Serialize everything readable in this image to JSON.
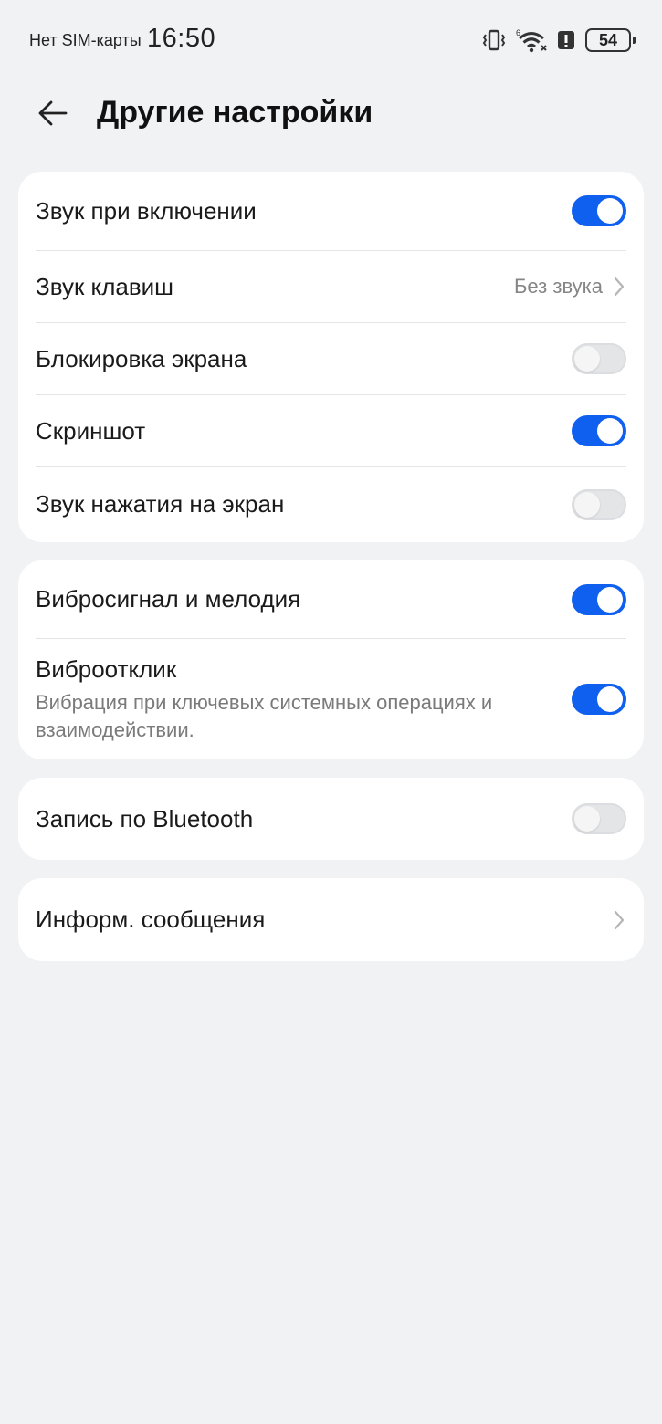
{
  "status_bar": {
    "carrier": "Нет SIM-карты",
    "time": "16:50",
    "battery": "54",
    "icons": [
      "vibrate-icon",
      "wifi-6-icon",
      "battery-saver-alert-icon",
      "battery-icon"
    ]
  },
  "header": {
    "title": "Другие настройки",
    "back_icon": "arrow-left-icon"
  },
  "groups": [
    {
      "items": [
        {
          "label": "Звук при включении",
          "type": "toggle",
          "on": true
        },
        {
          "label": "Звук клавиш",
          "type": "link",
          "value": "Без звука"
        },
        {
          "label": "Блокировка экрана",
          "type": "toggle",
          "on": false
        },
        {
          "label": "Скриншот",
          "type": "toggle",
          "on": true
        },
        {
          "label": "Звук нажатия на экран",
          "type": "toggle",
          "on": false
        }
      ]
    },
    {
      "items": [
        {
          "label": "Вибросигнал и мелодия",
          "type": "toggle",
          "on": true
        },
        {
          "label": "Виброотклик",
          "subtitle": "Вибрация при ключевых системных операциях и взаимодействии.",
          "type": "toggle",
          "on": true
        }
      ]
    },
    {
      "items": [
        {
          "label": "Запись по Bluetooth",
          "type": "toggle",
          "on": false
        }
      ]
    },
    {
      "items": [
        {
          "label": "Информ. сообщения",
          "type": "link"
        }
      ]
    }
  ],
  "colors": {
    "background": "#f1f2f4",
    "card": "#ffffff",
    "toggle_on": "#1060f0",
    "toggle_off": "#e4e5e7"
  }
}
